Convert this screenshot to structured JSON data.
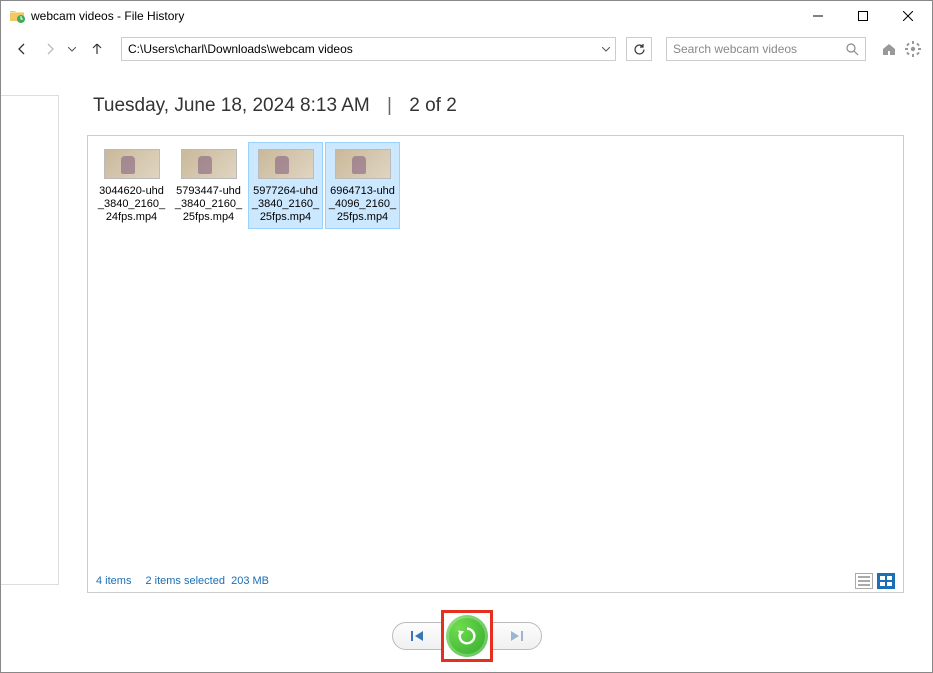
{
  "window": {
    "title": "webcam videos - File History"
  },
  "toolbar": {
    "path": "C:\\Users\\charl\\Downloads\\webcam videos",
    "search_placeholder": "Search webcam videos"
  },
  "header": {
    "timestamp": "Tuesday, June 18, 2024 8:13 AM",
    "position": "2 of 2"
  },
  "files": [
    {
      "name": "3044620-uhd_3840_2160_24fps.mp4",
      "selected": false
    },
    {
      "name": "5793447-uhd_3840_2160_25fps.mp4",
      "selected": false
    },
    {
      "name": "5977264-uhd_3840_2160_25fps.mp4",
      "selected": true
    },
    {
      "name": "6964713-uhd_4096_2160_25fps.mp4",
      "selected": true
    }
  ],
  "status": {
    "count": "4 items",
    "selection": "2 items selected",
    "size": "203 MB"
  }
}
